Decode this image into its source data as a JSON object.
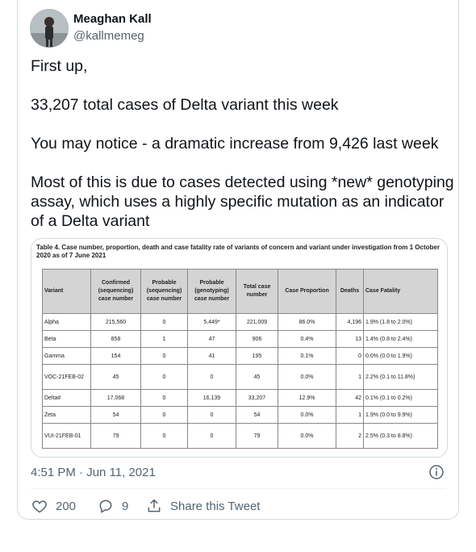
{
  "author": {
    "name": "Meaghan Kall",
    "handle": "@kallmemeg"
  },
  "tweet": {
    "text": "First up,\n\n33,207 total cases of Delta variant this week\n\nYou may notice - a dramatic increase from 9,426 last week\n\nMost of this is due to cases detected using *new* genotyping assay, which uses a highly specific mutation as an indicator of a Delta variant"
  },
  "media": {
    "caption": "Table 4. Case number, proportion, death and case fatality rate of variants of concern and variant under investigation from 1 October 2020 as of 7 June 2021",
    "headers": [
      "Variant",
      "Confirmed (sequencing) case number",
      "Probable (sequencing) case number",
      "Probable (genotyping) case number",
      "Total case number",
      "Case Proportion",
      "Deaths",
      "Case Fatality"
    ],
    "rows": [
      {
        "variant": "Alpha",
        "confirmed": "215,560",
        "prob_seq": "0",
        "prob_geno": "5,449*",
        "total": "221,009",
        "proportion": "86.0%",
        "deaths": "4,196",
        "fatality": "1.9% (1.8 to 2.0%)"
      },
      {
        "variant": "Beta",
        "confirmed": "858",
        "prob_seq": "1",
        "prob_geno": "47",
        "total": "906",
        "proportion": "0.4%",
        "deaths": "13",
        "fatality": "1.4% (0.8 to 2.4%)"
      },
      {
        "variant": "Gamma",
        "confirmed": "154",
        "prob_seq": "0",
        "prob_geno": "41",
        "total": "195",
        "proportion": "0.1%",
        "deaths": "0",
        "fatality": "0.0% (0.0 to 1.9%)"
      },
      {
        "variant": "VOC-21FEB-02",
        "confirmed": "45",
        "prob_seq": "0",
        "prob_geno": "0",
        "total": "45",
        "proportion": "0.0%",
        "deaths": "1",
        "fatality": "2.2% (0.1 to 11.8%)"
      },
      {
        "variant": "Delta#",
        "confirmed": "17,068",
        "prob_seq": "0",
        "prob_geno": "16,139",
        "total": "33,207",
        "proportion": "12.9%",
        "deaths": "42",
        "fatality": "0.1% (0.1 to 0.2%)"
      },
      {
        "variant": "Zeta",
        "confirmed": "54",
        "prob_seq": "0",
        "prob_geno": "0",
        "total": "54",
        "proportion": "0.0%",
        "deaths": "1",
        "fatality": "1.9% (0.0 to 9.9%)"
      },
      {
        "variant": "VUI-21FEB-01",
        "confirmed": "79",
        "prob_seq": "0",
        "prob_geno": "0",
        "total": "79",
        "proportion": "0.0%",
        "deaths": "2",
        "fatality": "2.5% (0.3 to 8.8%)"
      }
    ]
  },
  "meta": {
    "timestamp": "4:51 PM · Jun 11, 2021"
  },
  "actions": {
    "likes": "200",
    "replies": "9",
    "share_label": "Share this Tweet"
  },
  "colors": {
    "text": "#0f1419",
    "secondary": "#536471",
    "border": "#cfd9de"
  },
  "icons": [
    "info-icon",
    "heart-icon",
    "reply-icon",
    "share-icon"
  ]
}
